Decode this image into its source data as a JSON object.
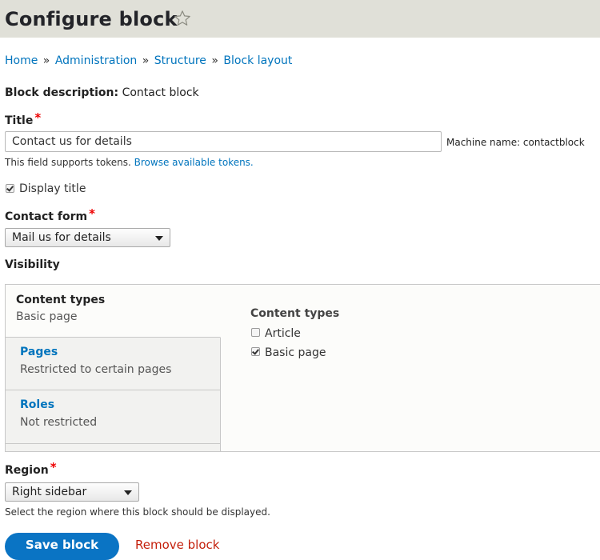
{
  "header": {
    "title": "Configure block",
    "favorite_icon": "star-outline-icon"
  },
  "breadcrumb": [
    "Home",
    "Administration",
    "Structure",
    "Block layout"
  ],
  "breadcrumb_separator": "»",
  "block_description": {
    "label": "Block description:",
    "value": "Contact block"
  },
  "title_field": {
    "label": "Title",
    "required_mark": "*",
    "value": "Contact us for details",
    "machine_name": "Machine name: contactblock",
    "help_text": "This field supports tokens.",
    "help_link": "Browse available tokens."
  },
  "display_title": {
    "label": "Display title",
    "checked": true
  },
  "contact_form": {
    "label": "Contact form",
    "required_mark": "*",
    "selected": "Mail us for details"
  },
  "visibility": {
    "label": "Visibility",
    "tabs": [
      {
        "title": "Content types",
        "summary": "Basic page",
        "active": true
      },
      {
        "title": "Pages",
        "summary": "Restricted to certain pages",
        "active": false
      },
      {
        "title": "Roles",
        "summary": "Not restricted",
        "active": false
      }
    ],
    "pane": {
      "title": "Content types",
      "options": [
        {
          "label": "Article",
          "checked": false
        },
        {
          "label": "Basic page",
          "checked": true
        }
      ]
    }
  },
  "region": {
    "label": "Region",
    "required_mark": "*",
    "selected": "Right sidebar",
    "help_text": "Select the region where this block should be displayed."
  },
  "actions": {
    "save_label": "Save block",
    "remove_label": "Remove block"
  },
  "colors": {
    "header_bg": "#e0e0d8",
    "link": "#0074bd",
    "primary_button": "#0a74c4",
    "danger_link": "#c4200c",
    "required": "#e00000"
  }
}
